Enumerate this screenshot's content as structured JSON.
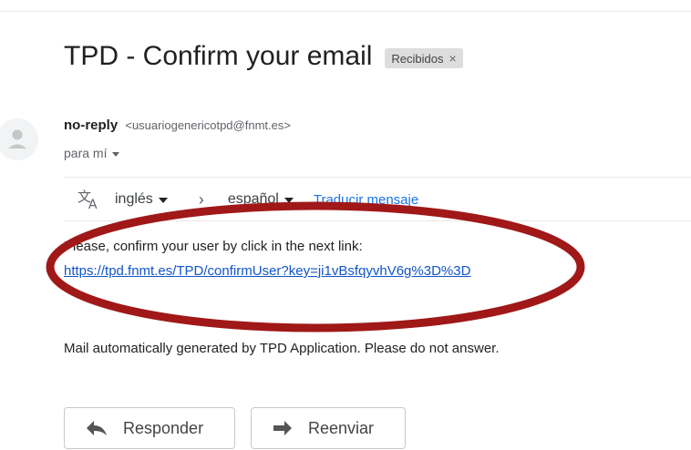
{
  "email": {
    "subject": "TPD - Confirm your email",
    "label_chip": "Recibidos",
    "label_close": "×",
    "sender_name": "no-reply",
    "sender_email": "<usuariogenericotpd@fnmt.es>",
    "recipient": "para mí",
    "translate": {
      "from_lang": "inglés",
      "to_lang": "español",
      "translate_link": "Traducir mensaje"
    },
    "body_line1": "Please, confirm your user by click in the next link:",
    "body_link": "https://tpd.fnmt.es/TPD/confirmUser?key=ji1vBsfqyvhV6g%3D%3D",
    "footer_note": "Mail automatically generated by TPD Application. Please do not answer."
  },
  "actions": {
    "reply_label": "Responder",
    "forward_label": "Reenviar"
  },
  "annotation": {
    "ellipse_color": "#a01818"
  },
  "icons": {
    "avatar": "person-icon",
    "translate": "translate-icon",
    "reply": "reply-icon",
    "forward": "forward-icon"
  }
}
